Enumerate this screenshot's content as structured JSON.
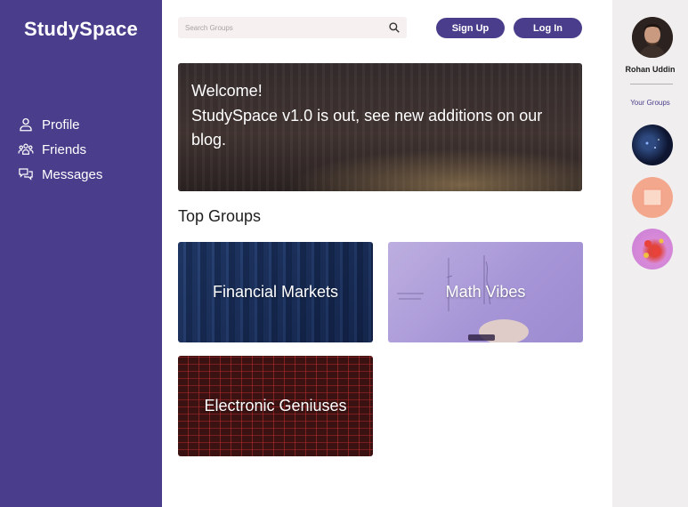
{
  "sidebar": {
    "brand": "StudySpace",
    "items": [
      {
        "label": "Profile",
        "icon": "user-icon"
      },
      {
        "label": "Friends",
        "icon": "people-icon"
      },
      {
        "label": "Messages",
        "icon": "chat-icon"
      }
    ]
  },
  "header": {
    "search_placeholder": "Search Groups",
    "signup_label": "Sign Up",
    "login_label": "Log In"
  },
  "banner": {
    "line1": "Welcome!",
    "line2": "StudySpace v1.0 is out, see new additions on our blog."
  },
  "top_groups": {
    "title": "Top Groups",
    "groups": [
      {
        "label": "Financial Markets"
      },
      {
        "label": "Math Vibes"
      },
      {
        "label": "Electronic Geniuses"
      }
    ]
  },
  "user": {
    "name": "Rohan Uddin",
    "your_groups_label": "Your Groups"
  },
  "colors": {
    "brand": "#4a3e8c",
    "right_panel": "#f0eeee",
    "search_bg": "#f6f0f0"
  }
}
